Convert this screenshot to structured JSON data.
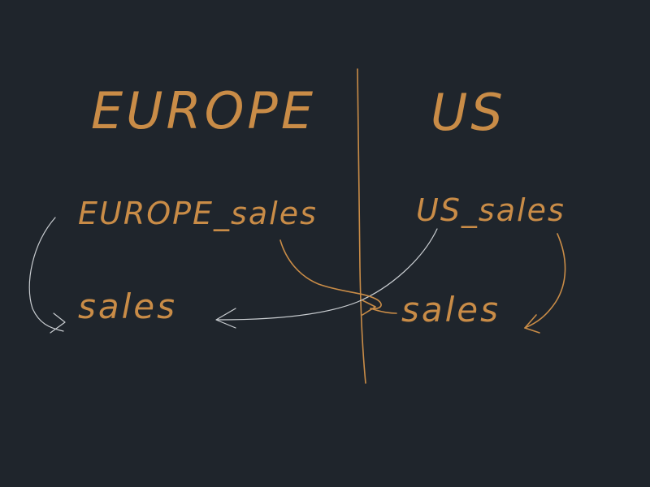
{
  "regions": {
    "left_title": "EUROPE",
    "right_title": "US"
  },
  "tables": {
    "europe_source": "EUROPE_sales",
    "us_source": "US_sales"
  },
  "targets": {
    "europe_target": "sales",
    "us_target": "sales"
  },
  "colors": {
    "background": "#1f252c",
    "ink_orange": "#c98c47",
    "ink_white": "#c9cdd1"
  }
}
